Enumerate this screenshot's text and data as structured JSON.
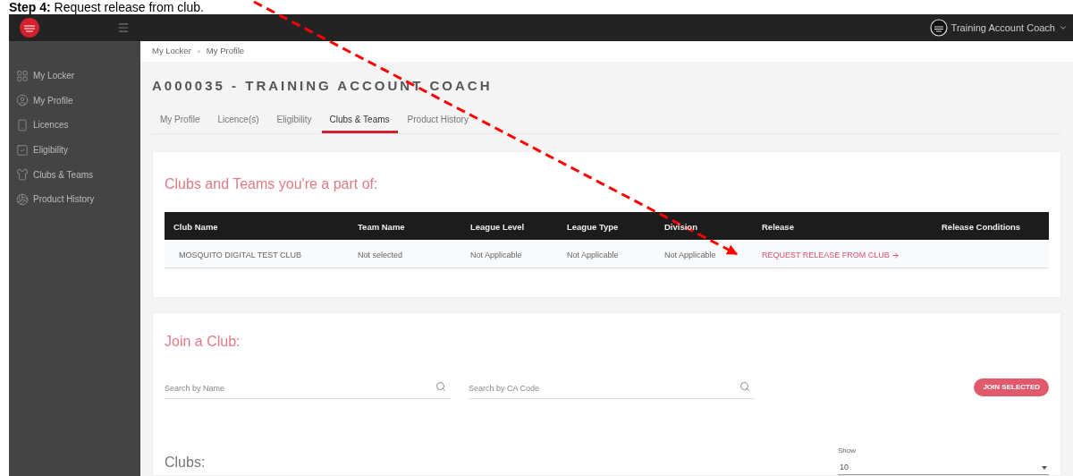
{
  "annotation": {
    "text": "**Step 4:** Request release from club."
  },
  "header": {
    "user": "Training Account Coach"
  },
  "sidebar": {
    "items": [
      {
        "label": "My Locker"
      },
      {
        "label": "My Profile"
      },
      {
        "label": "Licences"
      },
      {
        "label": "Eligibility"
      },
      {
        "label": "Clubs & Teams"
      },
      {
        "label": "Product History"
      }
    ]
  },
  "breadcrumb": [
    "My Locker",
    "My Profile"
  ],
  "title": "A000035 - TRAINING ACCOUNT COACH",
  "tabs": [
    {
      "label": "My Profile",
      "selected": false
    },
    {
      "label": "Licence(s)",
      "selected": false
    },
    {
      "label": "Eligibility",
      "selected": false
    },
    {
      "label": "Clubs & Teams",
      "selected": true
    },
    {
      "label": "Product History",
      "selected": false
    }
  ],
  "clubs_section": {
    "title": "Clubs and Teams you're a part of:",
    "table": {
      "columns": [
        "Club Name",
        "Team Name",
        "League Level",
        "League Type",
        "Division",
        "Release",
        "Release Conditions"
      ],
      "rows": [
        {
          "cells": [
            {
              "kind": "text",
              "text": "MOSQUITO DIGITAL TEST CLUB"
            },
            {
              "kind": "text",
              "text": "Not selected"
            },
            {
              "kind": "text",
              "text": "Not Applicable"
            },
            {
              "kind": "text",
              "text": "Not Applicable"
            },
            {
              "kind": "text",
              "text": "Not Applicable"
            },
            {
              "kind": "link",
              "text": "REQUEST RELEASE FROM CLUB"
            }
          ]
        }
      ]
    }
  },
  "join_section": {
    "title": "Join a Club:",
    "search_fields": [
      {
        "placeholder": "Search by Name"
      },
      {
        "placeholder": "Search by CA Code"
      }
    ],
    "button": "JOIN SELECTED",
    "clubs_heading": "Clubs:",
    "show": {
      "label": "Show",
      "value": "10"
    }
  }
}
